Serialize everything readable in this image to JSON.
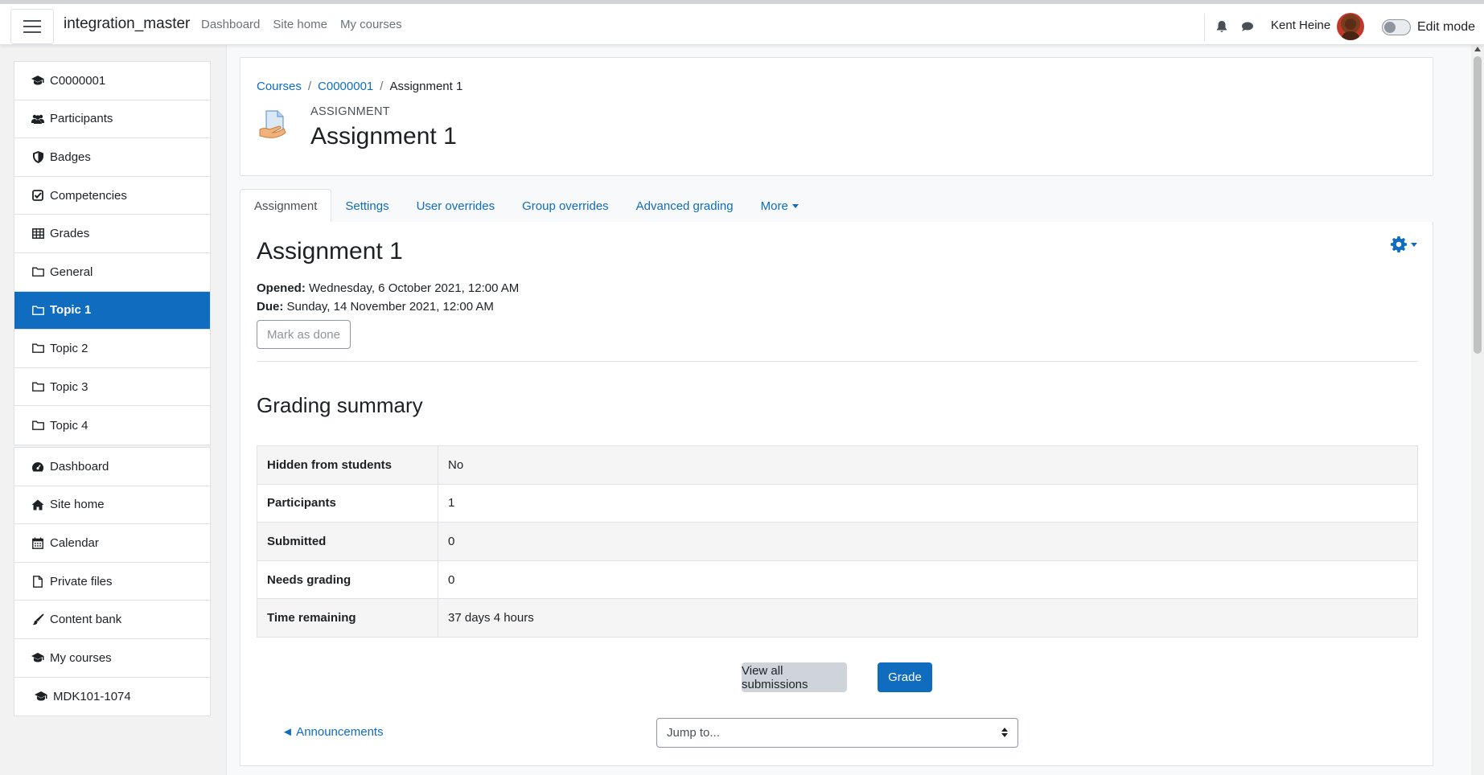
{
  "navbar": {
    "site_name": "integration_master",
    "links": [
      "Dashboard",
      "Site home",
      "My courses"
    ],
    "user_name": "Kent Heine",
    "edit_mode_label": "Edit mode",
    "edit_mode_on": false
  },
  "drawer": {
    "course_items": [
      {
        "label": "C0000001",
        "icon": "graduation-cap-icon"
      },
      {
        "label": "Participants",
        "icon": "users-icon"
      },
      {
        "label": "Badges",
        "icon": "shield-icon"
      },
      {
        "label": "Competencies",
        "icon": "check-square-icon"
      },
      {
        "label": "Grades",
        "icon": "table-icon"
      },
      {
        "label": "General",
        "icon": "folder-icon"
      },
      {
        "label": "Topic 1",
        "icon": "folder-icon",
        "active": true
      },
      {
        "label": "Topic 2",
        "icon": "folder-icon"
      },
      {
        "label": "Topic 3",
        "icon": "folder-icon"
      },
      {
        "label": "Topic 4",
        "icon": "folder-icon"
      }
    ],
    "site_items": [
      {
        "label": "Dashboard",
        "icon": "tachometer-icon"
      },
      {
        "label": "Site home",
        "icon": "home-icon"
      },
      {
        "label": "Calendar",
        "icon": "calendar-icon"
      },
      {
        "label": "Private files",
        "icon": "file-icon"
      },
      {
        "label": "Content bank",
        "icon": "paintbrush-icon"
      },
      {
        "label": "My courses",
        "icon": "graduation-cap-icon"
      },
      {
        "label": "MDK101-1074",
        "icon": "graduation-cap-icon"
      }
    ]
  },
  "header": {
    "breadcrumb": [
      "Courses",
      "C0000001",
      "Assignment 1"
    ],
    "module_label": "ASSIGNMENT",
    "title": "Assignment 1"
  },
  "tabs": [
    "Assignment",
    "Settings",
    "User overrides",
    "Group overrides",
    "Advanced grading",
    "More"
  ],
  "activity": {
    "title": "Assignment 1",
    "opened_label": "Opened:",
    "opened_value": "Wednesday, 6 October 2021, 12:00 AM",
    "due_label": "Due:",
    "due_value": "Sunday, 14 November 2021, 12:00 AM",
    "mark_done": "Mark as done"
  },
  "grading_summary": {
    "title": "Grading summary",
    "rows": [
      {
        "label": "Hidden from students",
        "value": "No"
      },
      {
        "label": "Participants",
        "value": "1"
      },
      {
        "label": "Submitted",
        "value": "0"
      },
      {
        "label": "Needs grading",
        "value": "0"
      },
      {
        "label": "Time remaining",
        "value": "37 days 4 hours"
      }
    ]
  },
  "buttons": {
    "view_all": "View all submissions",
    "grade": "Grade"
  },
  "footer_nav": {
    "prev": "◄ Announcements",
    "jump": "Jump to..."
  },
  "colors": {
    "primary": "#0f6cbf",
    "active_bg": "#0f6cbf"
  }
}
